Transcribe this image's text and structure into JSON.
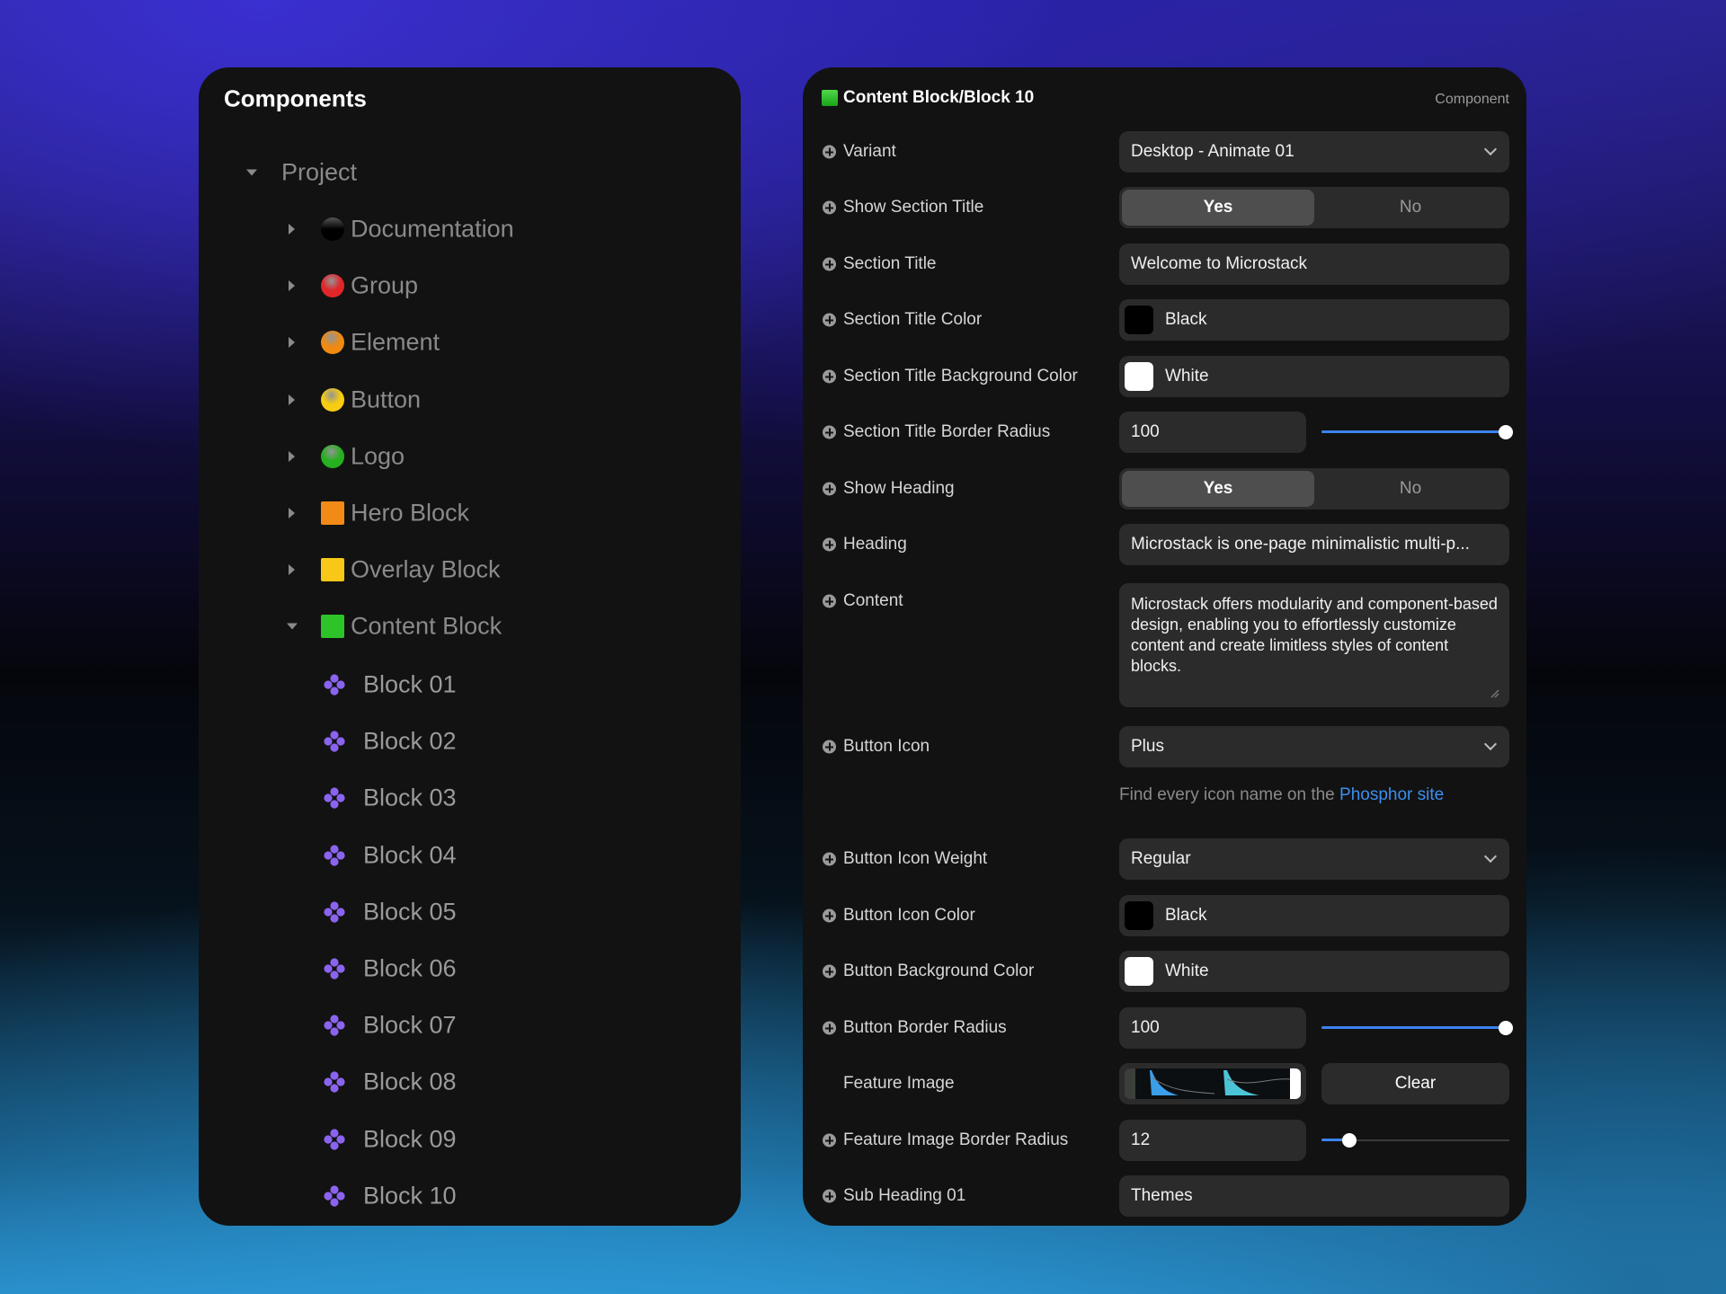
{
  "components_panel": {
    "title": "Components",
    "root": "Project",
    "groups": [
      {
        "label": "Documentation",
        "icon": "black-circle-icon",
        "color": "#1a1a1a",
        "shape": "circle"
      },
      {
        "label": "Group",
        "icon": "red-circle-icon",
        "color": "#e0262a",
        "shape": "circle"
      },
      {
        "label": "Element",
        "icon": "orange-circle-icon",
        "color": "#f08a10",
        "shape": "circle"
      },
      {
        "label": "Button",
        "icon": "yellow-circle-icon",
        "color": "#f8cc10",
        "shape": "circle"
      },
      {
        "label": "Logo",
        "icon": "green-circle-icon",
        "color": "#26b020",
        "shape": "circle"
      },
      {
        "label": "Hero Block",
        "icon": "orange-square-icon",
        "color": "#f28a18",
        "shape": "square"
      },
      {
        "label": "Overlay Block",
        "icon": "yellow-square-icon",
        "color": "#f8c818",
        "shape": "square"
      },
      {
        "label": "Content Block",
        "icon": "green-square-icon",
        "color": "#2cc428",
        "shape": "square",
        "expanded": true
      }
    ],
    "blocks": [
      "Block 01",
      "Block 02",
      "Block 03",
      "Block 04",
      "Block 05",
      "Block 06",
      "Block 07",
      "Block 08",
      "Block 09",
      "Block 10"
    ],
    "block_icon": "component-diamond-icon",
    "block_icon_color": "#8a63f0"
  },
  "properties_panel": {
    "title": "Content Block/Block 10",
    "type_label": "Component",
    "rows": [
      {
        "label": "Variant",
        "type": "select",
        "value": "Desktop - Animate 01"
      },
      {
        "label": "Show Section Title",
        "type": "toggle",
        "options": [
          "Yes",
          "No"
        ],
        "selected": "Yes"
      },
      {
        "label": "Section Title",
        "type": "text",
        "value": "Welcome to Microstack"
      },
      {
        "label": "Section Title Color",
        "type": "color",
        "value": "Black",
        "swatch": "#000000"
      },
      {
        "label": "Section Title Background Color",
        "type": "color",
        "value": "White",
        "swatch": "#ffffff"
      },
      {
        "label": "Section Title Border Radius",
        "type": "slider",
        "value": "100",
        "slider_level": 1.0
      },
      {
        "label": "Show Heading",
        "type": "toggle",
        "options": [
          "Yes",
          "No"
        ],
        "selected": "Yes"
      },
      {
        "label": "Heading",
        "type": "text",
        "value": "Microstack is one-page minimalistic multi-p..."
      },
      {
        "label": "Content",
        "type": "textarea",
        "value": "Microstack offers modularity and component-based design, enabling you to effortlessly customize content and create limitless styles of content blocks."
      },
      {
        "label": "Button Icon",
        "type": "select",
        "value": "Plus"
      },
      {
        "label": "Button Icon Weight",
        "type": "select",
        "value": "Regular"
      },
      {
        "label": "Button Icon Color",
        "type": "color",
        "value": "Black",
        "swatch": "#000000"
      },
      {
        "label": "Button Background Color",
        "type": "color",
        "value": "White",
        "swatch": "#ffffff"
      },
      {
        "label": "Button Border Radius",
        "type": "slider",
        "value": "100",
        "slider_level": 1.0
      },
      {
        "label": "Feature Image",
        "type": "image",
        "button": "Clear"
      },
      {
        "label": "Feature Image Border Radius",
        "type": "slider",
        "value": "12",
        "slider_level": 0.15
      },
      {
        "label": "Sub Heading 01",
        "type": "text",
        "value": "Themes"
      }
    ],
    "help": {
      "text": "Find every icon name on the ",
      "link": "Phosphor site"
    },
    "accent_color": "#3b82f0"
  }
}
